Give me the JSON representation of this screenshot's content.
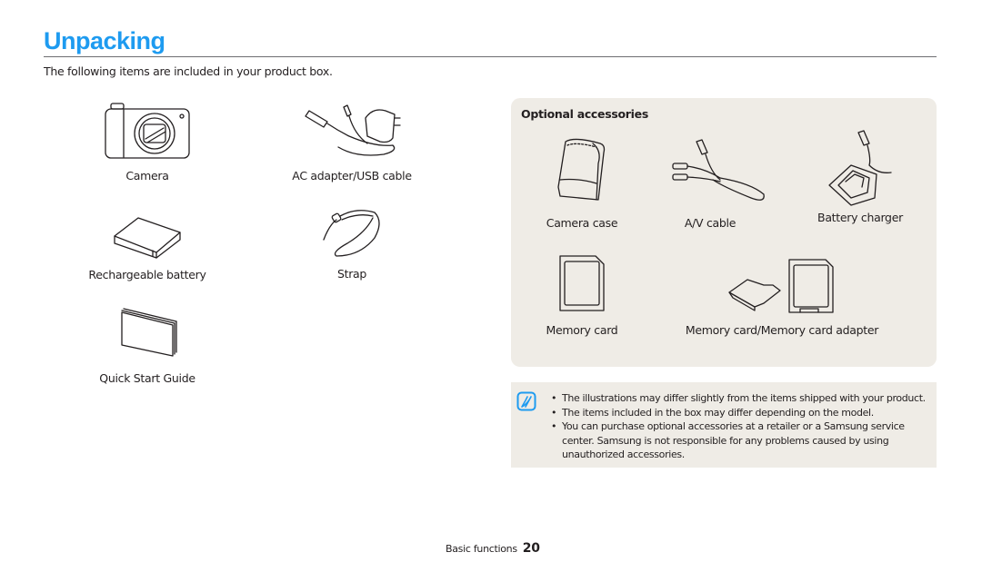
{
  "page": {
    "title": "Unpacking",
    "intro": "The following items are included in your product box.",
    "accent_color": "#1e9bf0",
    "panel_color": "#efece6"
  },
  "included_items": [
    {
      "label": "Camera",
      "icon": "camera-icon"
    },
    {
      "label": "AC adapter/USB cable",
      "icon": "ac-adapter-icon"
    },
    {
      "label": "Rechargeable battery",
      "icon": "battery-icon"
    },
    {
      "label": "Strap",
      "icon": "strap-icon"
    },
    {
      "label": "Quick Start Guide",
      "icon": "quick-start-guide-icon"
    }
  ],
  "optional_accessories": {
    "heading": "Optional accessories",
    "items": [
      {
        "label": "Camera case",
        "icon": "camera-case-icon"
      },
      {
        "label": "A/V cable",
        "icon": "av-cable-icon"
      },
      {
        "label": "Battery charger",
        "icon": "battery-charger-icon"
      },
      {
        "label": "Memory card",
        "icon": "memory-card-icon"
      },
      {
        "label": "Memory card/Memory card adapter",
        "icon": "memory-card-adapter-icon"
      }
    ]
  },
  "note": {
    "icon": "note-pencil-icon",
    "bullets": [
      "The illustrations may differ slightly from the items shipped with your product.",
      "The items included in the box may differ depending on the model.",
      "You can purchase optional accessories at a retailer or a Samsung service center. Samsung is not responsible for any problems caused by using unauthorized accessories."
    ]
  },
  "footer": {
    "section": "Basic functions",
    "page_number": "20"
  }
}
